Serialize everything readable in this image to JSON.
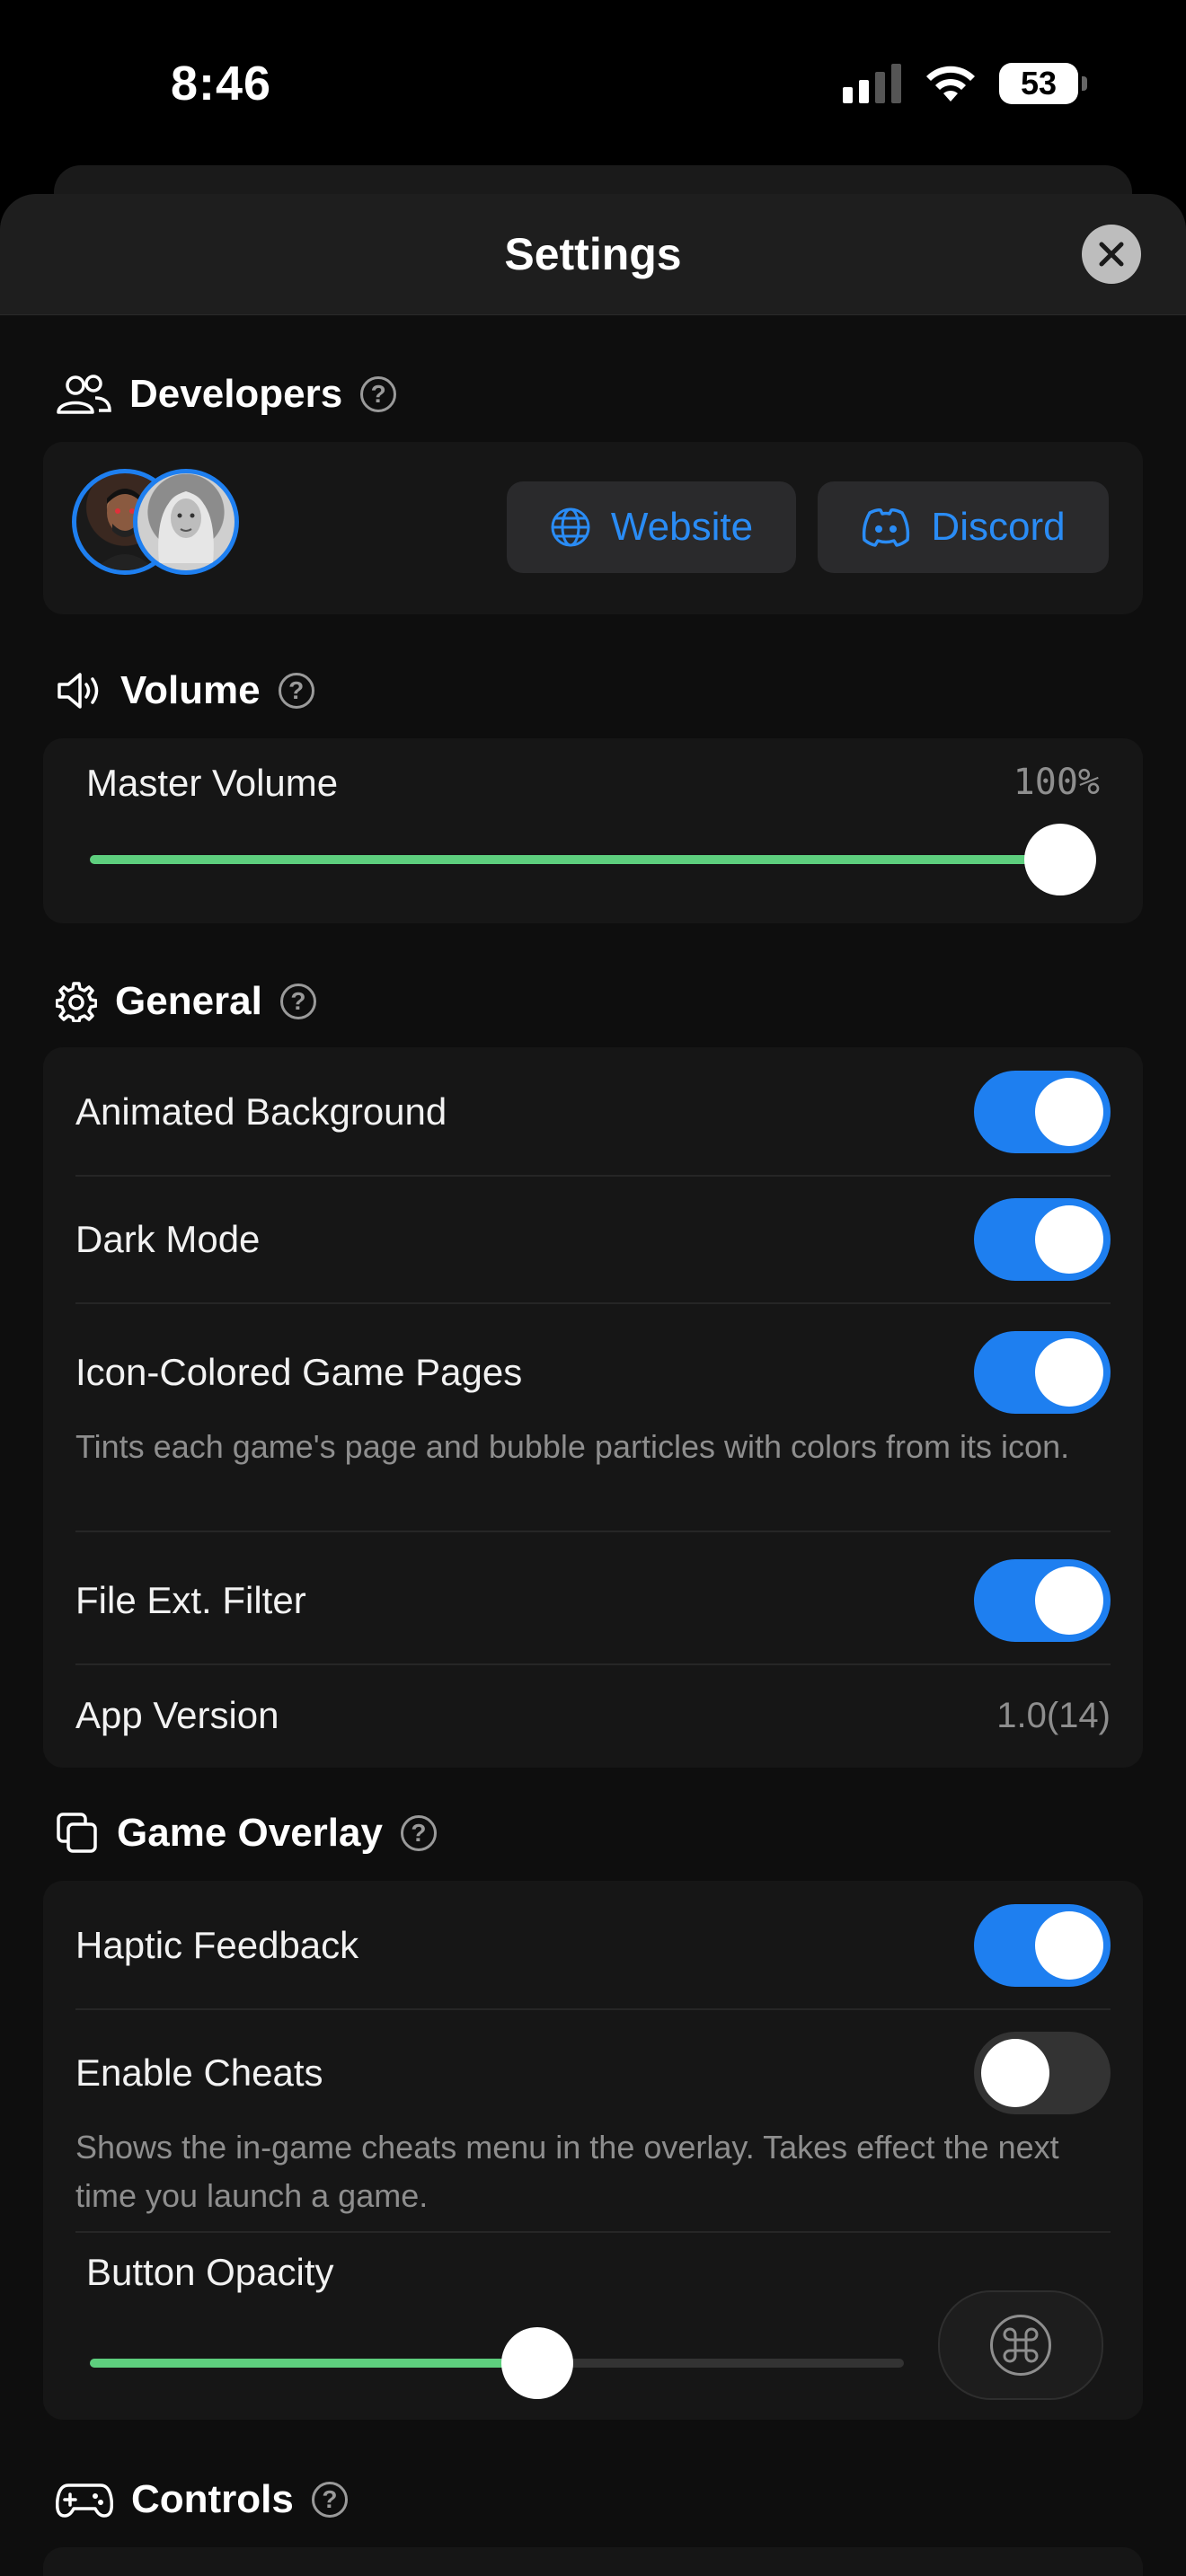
{
  "status_bar": {
    "time": "8:46",
    "battery": "53"
  },
  "header": {
    "title": "Settings"
  },
  "developers": {
    "title": "Developers",
    "website_label": "Website",
    "discord_label": "Discord"
  },
  "volume": {
    "title": "Volume",
    "master_label": "Master Volume",
    "master_value": "100%",
    "master_level": 1.0
  },
  "general": {
    "title": "General",
    "items": [
      {
        "label": "Animated Background",
        "on": true
      },
      {
        "label": "Dark Mode",
        "on": true
      },
      {
        "label": "Icon-Colored Game Pages",
        "on": true,
        "description": "Tints each game's page and bubble particles with colors from its icon."
      },
      {
        "label": "File Ext. Filter",
        "on": true
      }
    ],
    "version_label": "App Version",
    "version_value": "1.0(14)"
  },
  "overlay": {
    "title": "Game Overlay",
    "items": [
      {
        "label": "Haptic Feedback",
        "on": true
      },
      {
        "label": "Enable Cheats",
        "on": false,
        "description": "Shows the in-game cheats menu in the overlay. Takes effect the next time you launch a game."
      }
    ],
    "opacity_label": "Button Opacity",
    "opacity_level": 0.55
  },
  "controls": {
    "title": "Controls"
  },
  "colors": {
    "accent": "#1e7ff0",
    "slider": "#5ecf7e",
    "background": "#0e0e0e",
    "card": "#161616"
  }
}
